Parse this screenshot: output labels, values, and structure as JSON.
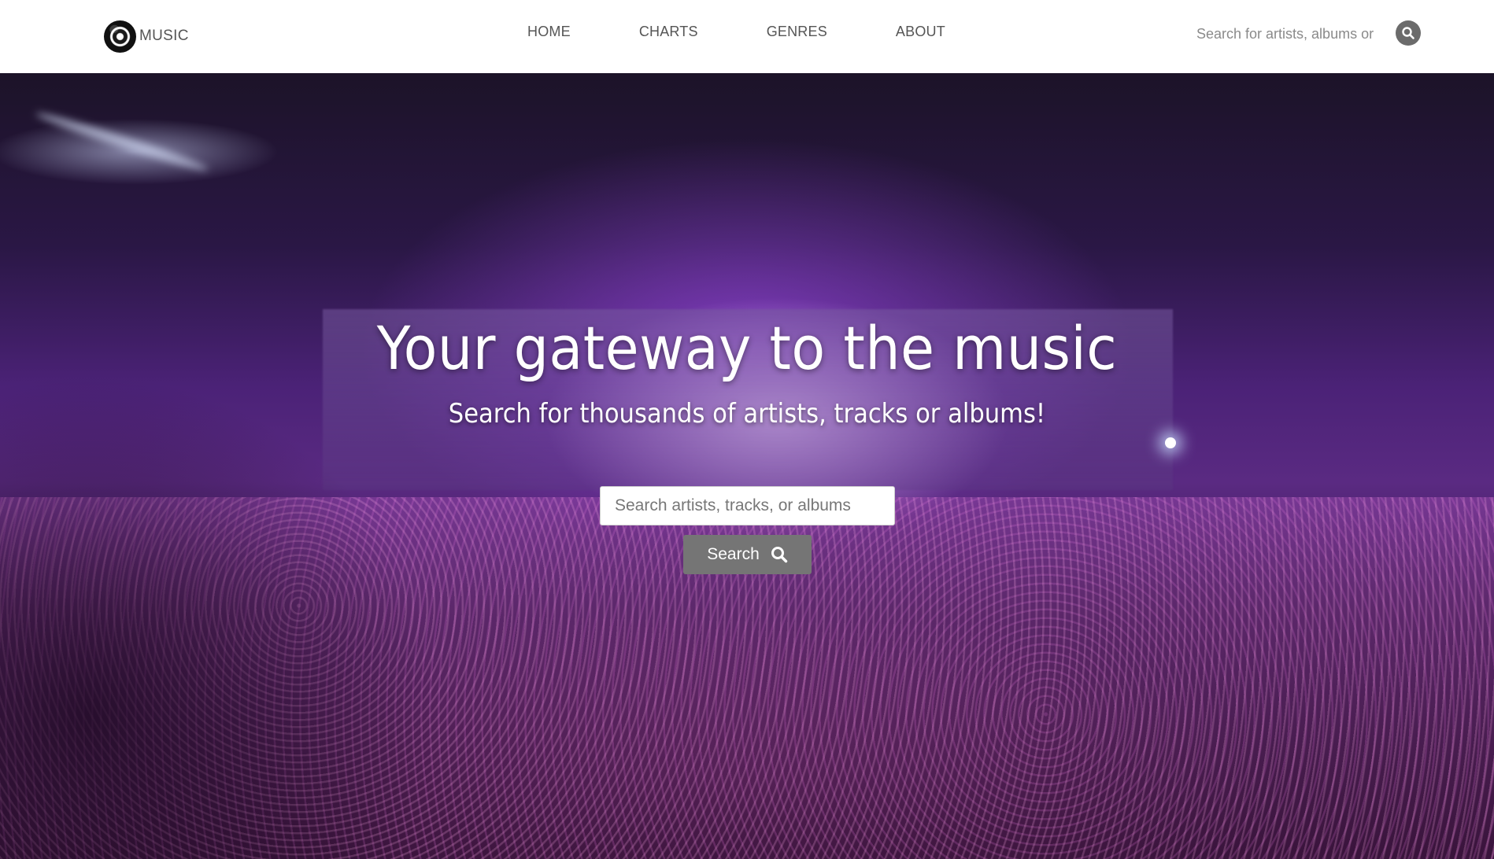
{
  "brand": {
    "name": "MUSIC",
    "logo_icon": "vinyl-record-icon"
  },
  "nav": {
    "links": [
      {
        "label": "HOME"
      },
      {
        "label": "CHARTS"
      },
      {
        "label": "GENRES"
      },
      {
        "label": "ABOUT"
      }
    ],
    "search": {
      "placeholder": "Search for artists, albums or tracks",
      "icon": "search-icon"
    }
  },
  "hero": {
    "title": "Your gateway to the music",
    "subtitle": "Search for thousands of artists, tracks or albums!",
    "search": {
      "placeholder": "Search artists, tracks, or albums"
    },
    "button": {
      "label": "Search",
      "icon": "search-icon"
    }
  },
  "colors": {
    "nav_background": "#ffffff",
    "nav_text": "#555555",
    "search_button": "#757575",
    "hero_tint": "#5a2a82"
  }
}
